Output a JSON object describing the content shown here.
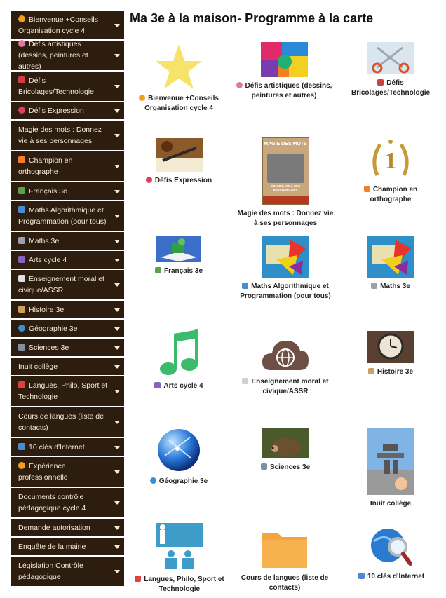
{
  "page": {
    "title": "Ma 3e à la maison- Programme à la carte"
  },
  "sidebar": {
    "items": [
      {
        "label": "Bienvenue +Conseils Organisation cycle 4",
        "icon": "smiley-icon",
        "color": "#f0a020"
      },
      {
        "label": "Défis artistiques (dessins, peintures et autres)",
        "icon": "palette-icon",
        "color": "#e07aa0"
      },
      {
        "label": "Défis Bricolages/Technologie",
        "icon": "scissors-icon",
        "color": "#d04040"
      },
      {
        "label": "Défis Expression",
        "icon": "grin-icon",
        "color": "#e04060"
      },
      {
        "label": "Magie des mots : Donnez vie à ses personnages",
        "icon": "",
        "color": ""
      },
      {
        "label": "Champion en orthographe",
        "icon": "pencil-icon",
        "color": "#f08030"
      },
      {
        "label": "Français 3e",
        "icon": "books-icon",
        "color": "#5aa050"
      },
      {
        "label": "Maths Algorithmique et Programmation (pour tous)",
        "icon": "laptop-icon",
        "color": "#4a8ad0"
      },
      {
        "label": "Maths 3e",
        "icon": "triangle-ruler-icon",
        "color": "#9aa0b0"
      },
      {
        "label": "Arts cycle 4",
        "icon": "music-note-icon",
        "color": "#8a60c0"
      },
      {
        "label": "Enseignement moral et civique/ASSR",
        "icon": "flag-icon",
        "color": "#e0e0e0"
      },
      {
        "label": "Histoire 3e",
        "icon": "hourglass-icon",
        "color": "#d0a060"
      },
      {
        "label": "Géographie 3e",
        "icon": "globe-icon",
        "color": "#3a90d0"
      },
      {
        "label": "Sciences 3e",
        "icon": "microscope-icon",
        "color": "#8090a0"
      },
      {
        "label": "Inuit collège",
        "icon": "",
        "color": ""
      },
      {
        "label": "Langues, Philo, Sport et Technologie",
        "icon": "gift-icon",
        "color": "#e04040"
      },
      {
        "label": "Cours de langues (liste de contacts)",
        "icon": "",
        "color": ""
      },
      {
        "label": "10 clés d'Internet",
        "icon": "computer-icon",
        "color": "#4a8ad0"
      },
      {
        "label": "Expérience professionnelle",
        "icon": "sun-icon",
        "color": "#f0a020"
      },
      {
        "label": "Documents contrôle pédagogique cycle 4",
        "icon": "",
        "color": ""
      },
      {
        "label": "Demande autorisation",
        "icon": "",
        "color": ""
      },
      {
        "label": "Enquête de la mairie",
        "icon": "",
        "color": ""
      },
      {
        "label": "Législation Contrôle pédagogique",
        "icon": "",
        "color": ""
      }
    ]
  },
  "tiles": [
    {
      "label": "Bienvenue +Conseils Organisation cycle 4",
      "image": "star-image"
    },
    {
      "label": "Défis artistiques (dessins, peintures et autres)",
      "image": "paint-image"
    },
    {
      "label": "Défis Bricolages/Technologie",
      "image": "scissors-image"
    },
    {
      "label": "Défis Expression",
      "image": "pen-image"
    },
    {
      "label": "Magie des mots : Donnez vie à ses personnages",
      "image": "book-cover-image",
      "book_title": "MAGIE DES MOTS",
      "book_sub": "DONNEZ VIE À SES PERSONNAGES"
    },
    {
      "label": "Champion en orthographe",
      "image": "laurel-medal-image",
      "medal_text": "1"
    },
    {
      "label": "Français 3e",
      "image": "popup-book-image"
    },
    {
      "label": "Maths Algorithmique et Programmation (pour tous)",
      "image": "geometry-image"
    },
    {
      "label": "Maths 3e",
      "image": "geometry-image"
    },
    {
      "label": "Arts cycle 4",
      "image": "music-note-image"
    },
    {
      "label": "Enseignement moral et civique/ASSR",
      "image": "cloud-globe-image"
    },
    {
      "label": "Histoire 3e",
      "image": "clock-image"
    },
    {
      "label": "Géographie 3e",
      "image": "glass-globe-image"
    },
    {
      "label": "Sciences 3e",
      "image": "hedgehog-image"
    },
    {
      "label": "Inuit collège",
      "image": "inukshuk-image"
    },
    {
      "label": "Langues, Philo, Sport et Technologie",
      "image": "classroom-image"
    },
    {
      "label": "Cours de langues (liste de contacts)",
      "image": "folder-image"
    },
    {
      "label": "10 clés d'Internet",
      "image": "globe-magnifier-image"
    }
  ]
}
